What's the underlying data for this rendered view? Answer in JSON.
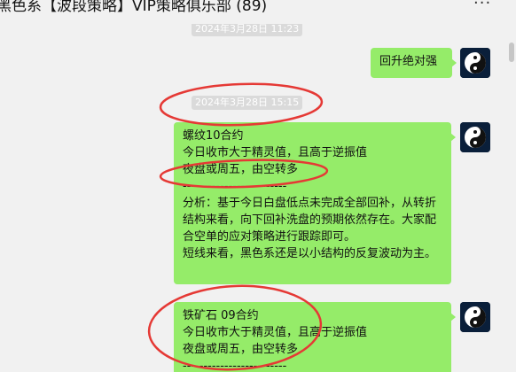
{
  "window": {
    "title": "黑色系【波段策略】VIP策略俱乐部 (89)",
    "more_icon": "more-icon"
  },
  "timestamps": [
    "2024年3月28日 11:23",
    "2024年3月28日 15:15"
  ],
  "messages": [
    {
      "lines": [
        "回升绝对强"
      ]
    },
    {
      "lines": [
        "螺纹10合约",
        "今日收市大于精灵值，且高于逆振值",
        "夜盘或周五，由空转多",
        "-------------------------",
        "分析：基于今日白盘低点未完成全部回补，从转折结构来看，向下回补洗盘的预期依然存在。大家配合空单的应对策略进行跟踪即可。",
        "短线来看，黑色系还是以小结构的反复波动为主。"
      ]
    },
    {
      "lines": [
        "铁矿石 09合约",
        "今日收市大于精灵值，且高于逆振值",
        "夜盘或周五，由空转多",
        "-------------------------"
      ]
    }
  ],
  "colors": {
    "bubble": "#95ec69",
    "background": "#f1f1f1",
    "annotation": "#e53935"
  }
}
